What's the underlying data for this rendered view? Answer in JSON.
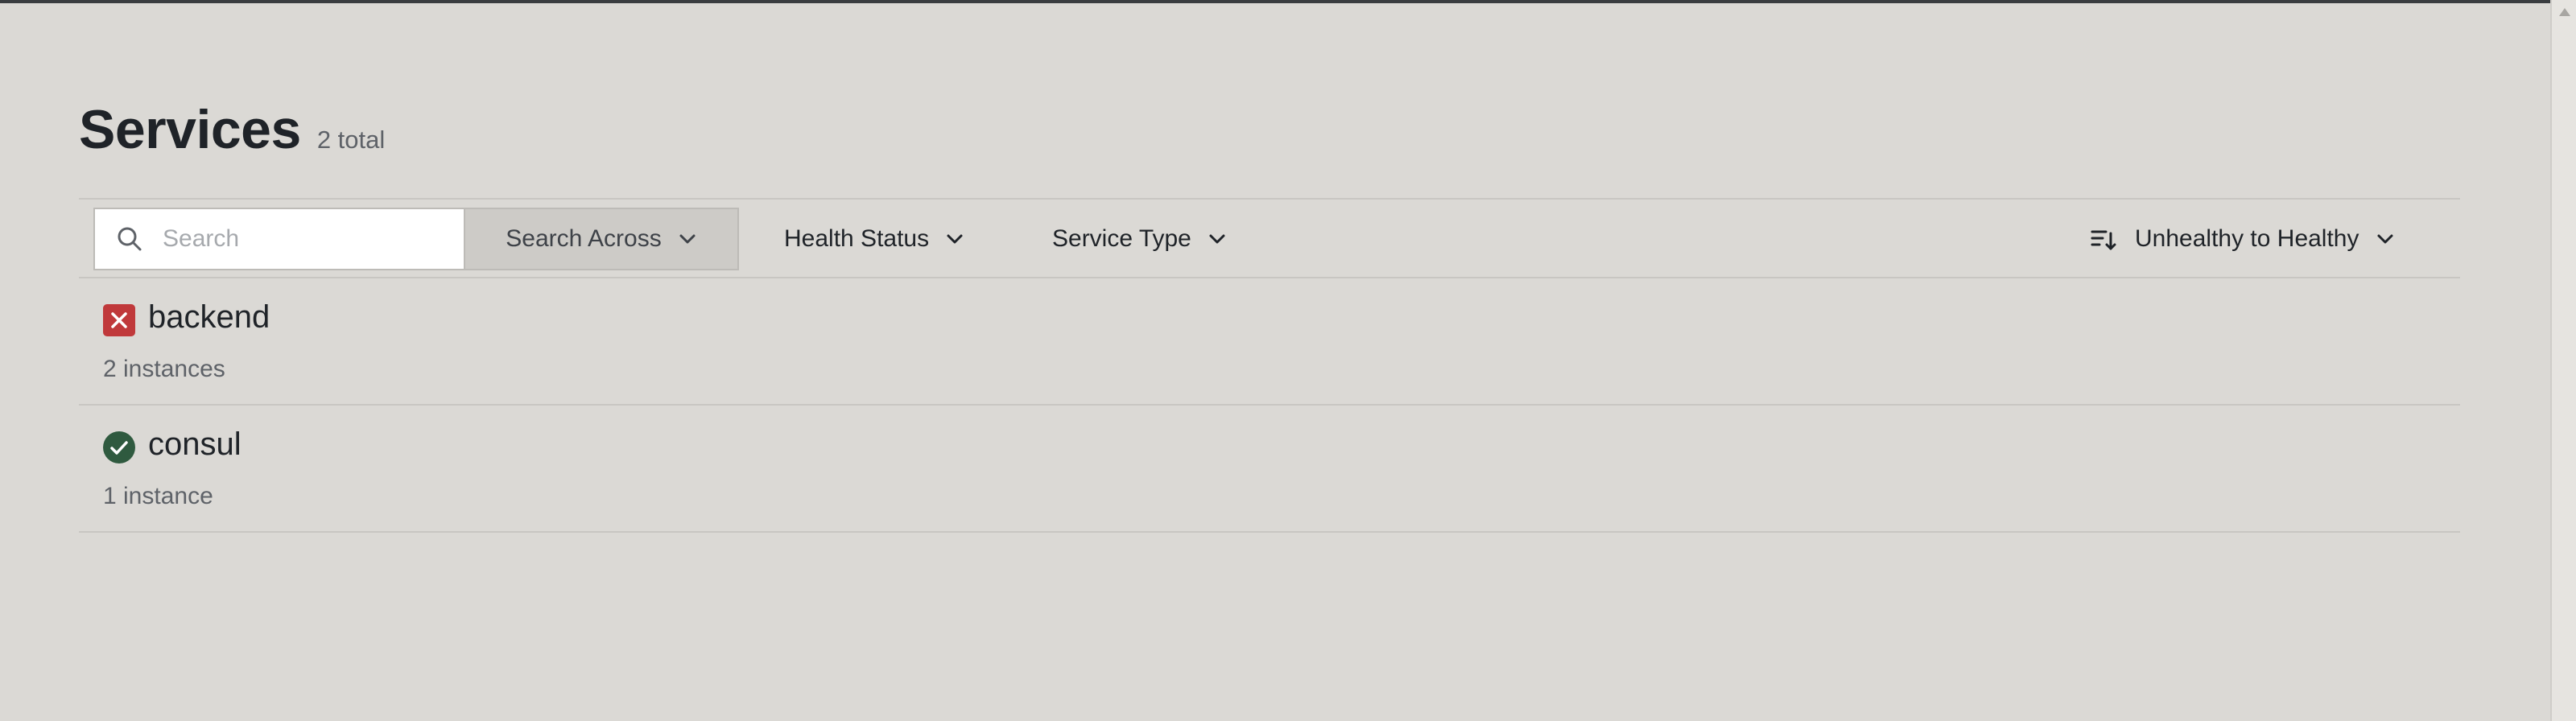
{
  "page": {
    "title": "Services",
    "count": "2 total"
  },
  "filters": {
    "search_placeholder": "Search",
    "search_value": "",
    "search_across_label": "Search Across",
    "health_status_label": "Health Status",
    "service_type_label": "Service Type",
    "sort_label": "Unhealthy to Healthy"
  },
  "services": [
    {
      "name": "backend",
      "instances": "2 instances",
      "status": "critical",
      "status_color": "#c0393b"
    },
    {
      "name": "consul",
      "instances": "1 instance",
      "status": "passing",
      "status_color": "#2f5a3f"
    }
  ],
  "icons": {
    "search": "search-icon",
    "chevron": "chevron-down-icon",
    "sort": "sort-icon",
    "critical": "x-square-icon",
    "passing": "check-circle-icon"
  }
}
